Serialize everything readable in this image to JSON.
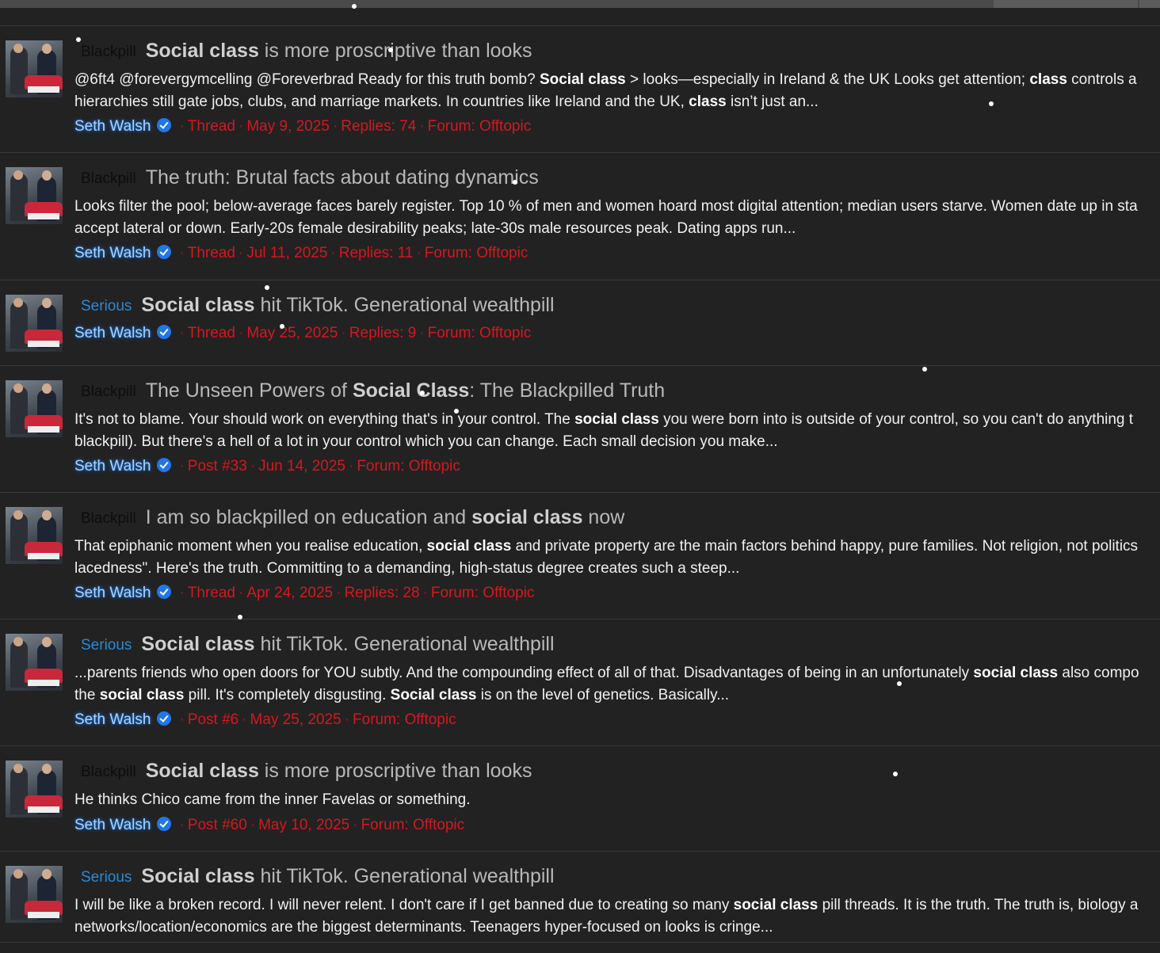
{
  "results": [
    {
      "prefix": "Blackpill",
      "prefix_type": "blackpill",
      "title_parts": [
        {
          "t": "Social class",
          "b": true
        },
        {
          "t": " is more proscriptive than looks",
          "b": false
        }
      ],
      "snippet_lines": [
        [
          {
            "t": "@6ft4 @forevergymcelling @Foreverbrad Ready for this truth bomb? ",
            "b": false
          },
          {
            "t": "Social class",
            "b": true
          },
          {
            "t": " > looks—especially in Ireland & the UK Looks get attention; ",
            "b": false
          },
          {
            "t": "class",
            "b": true
          },
          {
            "t": " controls a",
            "b": false
          }
        ],
        [
          {
            "t": "hierarchies still gate jobs, clubs, and marriage markets. In countries like Ireland and the UK, ",
            "b": false
          },
          {
            "t": "class",
            "b": true
          },
          {
            "t": " isn’t just an...",
            "b": false
          }
        ]
      ],
      "author": "Seth Walsh",
      "meta": [
        "Thread",
        "May 9, 2025",
        "Replies: 74",
        "Forum: Offtopic"
      ]
    },
    {
      "prefix": "Blackpill",
      "prefix_type": "blackpill",
      "title_parts": [
        {
          "t": "The truth: Brutal facts about dating dynamics",
          "b": false
        }
      ],
      "snippet_lines": [
        [
          {
            "t": "Looks filter the pool; below-average faces barely register. Top 10 % of men and women hoard most digital attention; median users starve. Women date up in sta",
            "b": false
          }
        ],
        [
          {
            "t": "accept lateral or down. Early-20s female desirability peaks; late-30s male resources peak. Dating apps run...",
            "b": false
          }
        ]
      ],
      "author": "Seth Walsh",
      "meta": [
        "Thread",
        "Jul 11, 2025",
        "Replies: 11",
        "Forum: Offtopic"
      ]
    },
    {
      "prefix": "Serious",
      "prefix_type": "serious",
      "title_parts": [
        {
          "t": "Social class",
          "b": true
        },
        {
          "t": " hit TikTok. Generational wealthpill",
          "b": false
        }
      ],
      "snippet_lines": [],
      "author": "Seth Walsh",
      "meta": [
        "Thread",
        "May 25, 2025",
        "Replies: 9",
        "Forum: Offtopic"
      ]
    },
    {
      "prefix": "Blackpill",
      "prefix_type": "blackpill",
      "title_parts": [
        {
          "t": "The Unseen Powers of ",
          "b": false
        },
        {
          "t": "Social Class",
          "b": true
        },
        {
          "t": ": The Blackpilled Truth",
          "b": false
        }
      ],
      "snippet_lines": [
        [
          {
            "t": "It's not to blame. Your should work on everything that's in your control. The ",
            "b": false
          },
          {
            "t": "social class",
            "b": true
          },
          {
            "t": " you were born into is outside of your control, so you can't do anything t",
            "b": false
          }
        ],
        [
          {
            "t": "blackpill). But there's a hell of a lot in your control which you can change. Each small decision you make...",
            "b": false
          }
        ]
      ],
      "author": "Seth Walsh",
      "meta": [
        "Post #33",
        "Jun 14, 2025",
        "Forum: Offtopic"
      ]
    },
    {
      "prefix": "Blackpill",
      "prefix_type": "blackpill",
      "title_parts": [
        {
          "t": "I am so blackpilled on education and ",
          "b": false
        },
        {
          "t": "social class",
          "b": true
        },
        {
          "t": " now",
          "b": false
        }
      ],
      "snippet_lines": [
        [
          {
            "t": "That epiphanic moment when you realise education, ",
            "b": false
          },
          {
            "t": "social class",
            "b": true
          },
          {
            "t": " and private property are the main factors behind happy, pure families. Not religion, not politics",
            "b": false
          }
        ],
        [
          {
            "t": "lacedness\". Here's the truth. Committing to a demanding, high-status degree creates such a steep...",
            "b": false
          }
        ]
      ],
      "author": "Seth Walsh",
      "meta": [
        "Thread",
        "Apr 24, 2025",
        "Replies: 28",
        "Forum: Offtopic"
      ]
    },
    {
      "prefix": "Serious",
      "prefix_type": "serious",
      "title_parts": [
        {
          "t": "Social class",
          "b": true
        },
        {
          "t": " hit TikTok. Generational wealthpill",
          "b": false
        }
      ],
      "snippet_lines": [
        [
          {
            "t": "...parents friends who open doors for YOU subtly. And the compounding effect of all of that. Disadvantages of being in an unfortunately ",
            "b": false
          },
          {
            "t": "social class",
            "b": true
          },
          {
            "t": " also compo",
            "b": false
          }
        ],
        [
          {
            "t": "the ",
            "b": false
          },
          {
            "t": "social class",
            "b": true
          },
          {
            "t": " pill. It's completely disgusting. ",
            "b": false
          },
          {
            "t": "Social class",
            "b": true
          },
          {
            "t": " is on the level of genetics. Basically...",
            "b": false
          }
        ]
      ],
      "author": "Seth Walsh",
      "meta": [
        "Post #6",
        "May 25, 2025",
        "Forum: Offtopic"
      ]
    },
    {
      "prefix": "Blackpill",
      "prefix_type": "blackpill",
      "title_parts": [
        {
          "t": "Social class",
          "b": true
        },
        {
          "t": " is more proscriptive than looks",
          "b": false
        }
      ],
      "snippet_lines": [
        [
          {
            "t": "He thinks Chico came from the inner Favelas or something.",
            "b": false
          }
        ]
      ],
      "author": "Seth Walsh",
      "meta": [
        "Post #60",
        "May 10, 2025",
        "Forum: Offtopic"
      ]
    },
    {
      "prefix": "Serious",
      "prefix_type": "serious",
      "title_parts": [
        {
          "t": "Social class",
          "b": true
        },
        {
          "t": " hit TikTok. Generational wealthpill",
          "b": false
        }
      ],
      "snippet_lines": [
        [
          {
            "t": "I will be like a broken record. I will never relent. I don't care if I get banned due to creating so many ",
            "b": false
          },
          {
            "t": "social class",
            "b": true
          },
          {
            "t": " pill threads. It is the truth. The truth is, biology a",
            "b": false
          }
        ],
        [
          {
            "t": "networks/location/economics are the biggest determinants. Teenagers hyper-focused on looks is cringe...",
            "b": false
          }
        ]
      ],
      "author": "",
      "meta": []
    }
  ]
}
